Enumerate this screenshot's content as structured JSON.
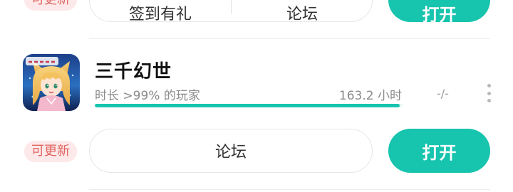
{
  "top_card": {
    "update_badge": "可更新",
    "checkin_label": "签到有礼",
    "forum_label": "论坛",
    "open_label": "打开"
  },
  "game": {
    "icon": "game-app-icon",
    "title": "三千幻世",
    "play_desc": "时长 >99% 的玩家",
    "play_hours": "163.2 小时",
    "progress": 0.99,
    "rating": "-/-",
    "update_badge": "可更新",
    "forum_label": "论坛",
    "open_label": "打开"
  },
  "colors": {
    "accent": "#17c4ae",
    "badge_bg": "#fde9e9",
    "badge_text": "#e0635f"
  }
}
